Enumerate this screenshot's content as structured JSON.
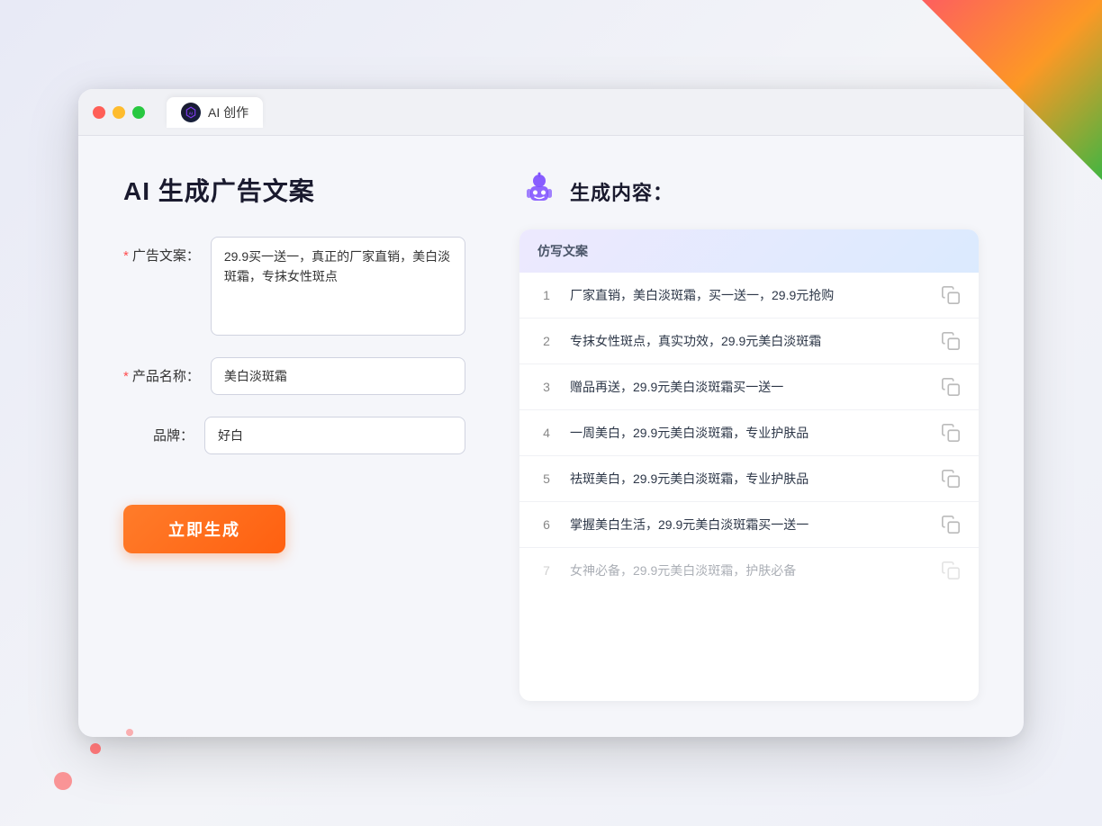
{
  "browser": {
    "tab_label": "AI 创作",
    "traffic_lights": [
      "red",
      "yellow",
      "green"
    ]
  },
  "left_panel": {
    "title": "AI 生成广告文案",
    "form": {
      "ad_copy_label": "广告文案：",
      "ad_copy_required": "*",
      "ad_copy_value": "29.9买一送一，真正的厂家直销，美白淡斑霜，专抹女性斑点",
      "product_name_label": "产品名称：",
      "product_name_required": "*",
      "product_name_value": "美白淡斑霜",
      "brand_label": "品牌：",
      "brand_value": "好白",
      "generate_btn_label": "立即生成"
    }
  },
  "right_panel": {
    "header_title": "生成内容：",
    "table_header": "仿写文案",
    "results": [
      {
        "num": "1",
        "text": "厂家直销，美白淡斑霜，买一送一，29.9元抢购"
      },
      {
        "num": "2",
        "text": "专抹女性斑点，真实功效，29.9元美白淡斑霜"
      },
      {
        "num": "3",
        "text": "赠品再送，29.9元美白淡斑霜买一送一"
      },
      {
        "num": "4",
        "text": "一周美白，29.9元美白淡斑霜，专业护肤品"
      },
      {
        "num": "5",
        "text": "祛斑美白，29.9元美白淡斑霜，专业护肤品"
      },
      {
        "num": "6",
        "text": "掌握美白生活，29.9元美白淡斑霜买一送一"
      },
      {
        "num": "7",
        "text": "女神必备，29.9元美白淡斑霜，护肤必备",
        "faded": true
      }
    ]
  }
}
